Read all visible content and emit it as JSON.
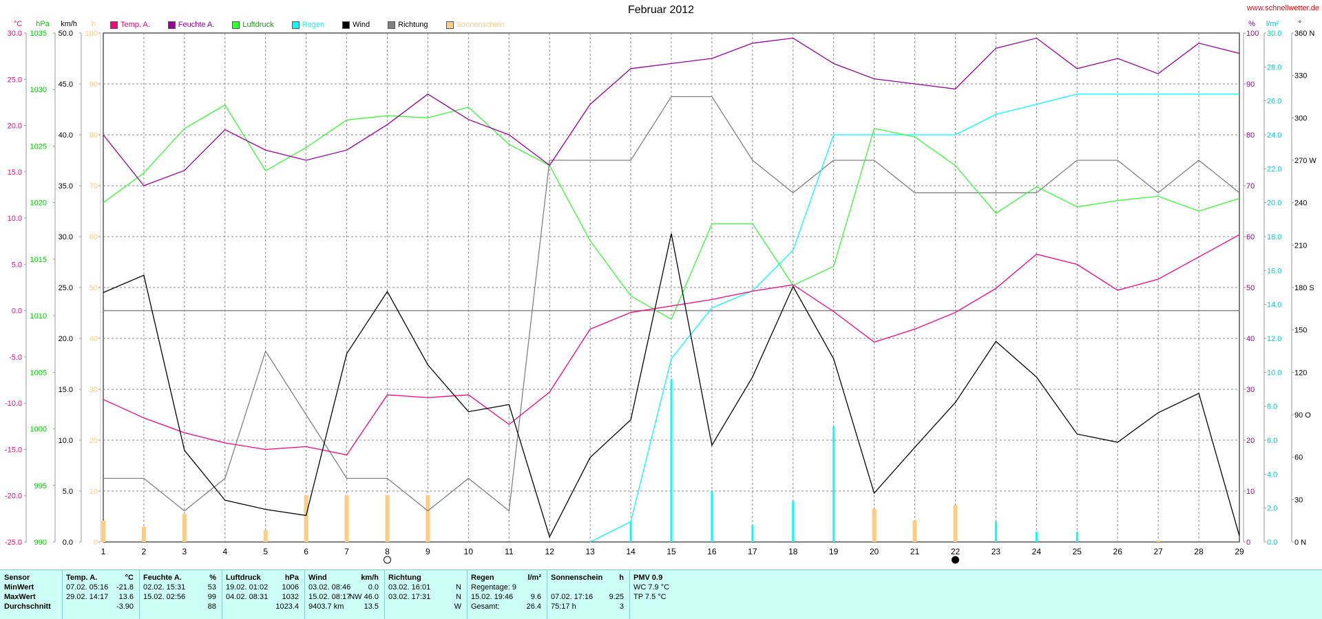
{
  "header": {
    "title": "Februar 2012",
    "brand": "www.schnellwetter.de"
  },
  "axes_units": {
    "temp": "°C",
    "pressure": "hPa",
    "wind": "km/h",
    "sun": "h",
    "humidity": "%",
    "rain": "l/m²",
    "direction": "°"
  },
  "legend": [
    {
      "label": "Temp. A.",
      "color": "#ff0080"
    },
    {
      "label": "Feuchte A.",
      "color": "#990099"
    },
    {
      "label": "Luftdruck",
      "color": "#33ff33"
    },
    {
      "label": "Regen",
      "color": "#00ffff"
    },
    {
      "label": "Wind",
      "color": "#000000"
    },
    {
      "label": "Richtung",
      "color": "#808080"
    },
    {
      "label": "Sonnenschein",
      "color": "#ffcc80"
    }
  ],
  "chart_data": {
    "type": "line",
    "title": "Februar 2012",
    "x": [
      1,
      2,
      3,
      4,
      5,
      6,
      7,
      8,
      9,
      10,
      11,
      12,
      13,
      14,
      15,
      16,
      17,
      18,
      19,
      20,
      21,
      22,
      23,
      24,
      25,
      26,
      27,
      28,
      29
    ],
    "x_ticks": [
      "1",
      "2",
      "3",
      "4",
      "5",
      "6",
      "7",
      "8",
      "9",
      "10",
      "11",
      "12",
      "13",
      "14",
      "15",
      "16",
      "17",
      "18",
      "19",
      "20",
      "21",
      "22",
      "23",
      "24",
      "25",
      "26",
      "27",
      "28",
      "29"
    ],
    "grid": true,
    "axes": {
      "temp": {
        "unit": "°C",
        "range": [
          -25,
          30
        ],
        "ticks": [
          "30.0",
          "25.0",
          "20.0",
          "15.0",
          "10.0",
          "5.0",
          "0.0",
          "-5.0",
          "-10.0",
          "-15.0",
          "-20.0",
          "-25.0"
        ],
        "color": "#ff0080"
      },
      "pressure": {
        "unit": "hPa",
        "range": [
          990,
          1038
        ],
        "ticks": [
          "1035",
          "1030",
          "1025",
          "1020",
          "1015",
          "1010",
          "1005",
          "1000",
          "995",
          "990"
        ],
        "color": "#00cc00"
      },
      "wind": {
        "unit": "km/h",
        "range": [
          0,
          50
        ],
        "ticks": [
          "50.0",
          "45.0",
          "40.0",
          "35.0",
          "30.0",
          "25.0",
          "20.0",
          "15.0",
          "10.0",
          "5.0",
          "0.0"
        ],
        "color": "#000000"
      },
      "sun": {
        "unit": "h",
        "range": [
          0,
          100
        ],
        "ticks": [
          "100",
          "90",
          "80",
          "70",
          "60",
          "50",
          "40",
          "30",
          "20",
          "10",
          "0"
        ],
        "color": "#ffcc80"
      },
      "humidity": {
        "unit": "%",
        "range": [
          0,
          100
        ],
        "ticks": [
          "100",
          "90",
          "80",
          "70",
          "60",
          "50",
          "40",
          "30",
          "20",
          "10",
          "0"
        ],
        "color": "#990099"
      },
      "rain": {
        "unit": "l/m²",
        "range": [
          0,
          30
        ],
        "ticks": [
          "30.0",
          "28.0",
          "26.0",
          "24.0",
          "22.0",
          "20.0",
          "18.0",
          "16.0",
          "14.0",
          "12.0",
          "10.0",
          "8.0",
          "6.0",
          "4.0",
          "2.0",
          "0.0"
        ],
        "color": "#00ffff"
      },
      "direction": {
        "unit": "°",
        "range": [
          0,
          360
        ],
        "ticks": [
          "360 N",
          "330",
          "300",
          "270 W",
          "240",
          "210",
          "180 S",
          "150",
          "120",
          "90 O",
          "60",
          "30",
          "0 N"
        ],
        "color": "#000000"
      }
    },
    "series": [
      {
        "name": "Temp. A.",
        "axis": "temp",
        "color": "#ff0080",
        "values": [
          -9.6,
          -11.6,
          -13.2,
          -14.3,
          -15.0,
          -14.7,
          -15.6,
          -9.1,
          -9.4,
          -9.1,
          -12.3,
          -8.8,
          -2.0,
          -0.2,
          0.5,
          1.2,
          2.1,
          2.8,
          -0.1,
          -3.4,
          -2.0,
          -0.2,
          2.4,
          6.1,
          5.0,
          2.2,
          3.4,
          5.8,
          8.2
        ]
      },
      {
        "name": "Feuchte A.",
        "axis": "humidity",
        "color": "#990099",
        "values": [
          80,
          70,
          73,
          81,
          77,
          75,
          77,
          82,
          88,
          83,
          80,
          74,
          86,
          93,
          94,
          95,
          98,
          99,
          94,
          91,
          90,
          89,
          97,
          99,
          93,
          95,
          92,
          98,
          96
        ]
      },
      {
        "name": "Luftdruck",
        "axis": "pressure",
        "color": "#33ff33",
        "values": [
          1022,
          1024.8,
          1029,
          1031.2,
          1025,
          1027.2,
          1029.8,
          1030.2,
          1030,
          1031,
          1027.5,
          1025.5,
          1018.4,
          1013.2,
          1011,
          1020,
          1020,
          1014.2,
          1016,
          1029,
          1028.2,
          1025.5,
          1021,
          1023.5,
          1021.6,
          1022.2,
          1022.6,
          1021.2,
          1022.4
        ]
      },
      {
        "name": "Regen",
        "axis": "rain",
        "color": "#00ffff",
        "values": [
          null,
          null,
          null,
          null,
          null,
          null,
          null,
          null,
          null,
          null,
          null,
          null,
          0,
          1.2,
          10.8,
          13.8,
          14.8,
          17.2,
          24,
          24,
          24,
          24,
          25.2,
          25.8,
          26.4,
          26.4,
          26.4,
          26.4,
          26.4
        ]
      },
      {
        "name": "Wind",
        "axis": "wind",
        "color": "#000000",
        "values": [
          24.5,
          26.2,
          9.0,
          4.1,
          3.2,
          2.6,
          18.5,
          24.6,
          17.4,
          12.8,
          13.5,
          0.5,
          8.3,
          12.0,
          30.3,
          9.5,
          16.2,
          25.1,
          18.0,
          4.8,
          9.3,
          13.7,
          19.7,
          16.2,
          10.6,
          9.8,
          12.7,
          14.6,
          0.6
        ]
      },
      {
        "name": "Richtung",
        "axis": "direction",
        "color": "#808080",
        "values": [
          45,
          45,
          22,
          45,
          135,
          90,
          45,
          45,
          22,
          45,
          22,
          270,
          270,
          270,
          315,
          315,
          270,
          247,
          270,
          270,
          247,
          247,
          247,
          247,
          270,
          270,
          247,
          270,
          247
        ]
      }
    ],
    "bars": [
      {
        "name": "Sonnenschein",
        "axis": "sun",
        "color": "#ffcc80",
        "values": [
          4.2,
          3.0,
          5.5,
          0,
          2.3,
          9.2,
          9.2,
          9.2,
          9.2,
          0,
          0,
          0,
          0,
          0,
          0,
          0,
          0,
          0,
          0,
          6.5,
          4.2,
          7.2,
          0,
          0,
          0,
          0,
          0.3,
          0,
          0
        ]
      },
      {
        "name": "Regen (Tag)",
        "axis": "rain",
        "color": "#00ffff",
        "values": [
          0,
          0,
          0,
          0,
          0,
          0,
          0,
          0,
          0,
          0,
          0,
          0,
          0,
          1.2,
          9.6,
          3.0,
          1.0,
          2.4,
          6.8,
          0,
          0,
          0,
          1.2,
          0.6,
          0.6,
          0,
          0,
          0,
          0
        ]
      }
    ],
    "sun_bar_colors_green_days": [
      19,
      25
    ],
    "moon": [
      {
        "day": 8,
        "phase": "full"
      },
      {
        "day": 22,
        "phase": "new"
      }
    ]
  },
  "table": {
    "sensor": {
      "header": "Sensor",
      "rows": [
        "MinWert",
        "MaxWert",
        "Durchschnitt"
      ]
    },
    "temp": {
      "header": "Temp. A.",
      "unit": "°C",
      "rows": [
        {
          "date": "07.02.",
          "time": "05:16",
          "value": "-21.8"
        },
        {
          "date": "29.02.",
          "time": "14:17",
          "value": "13.6"
        },
        {
          "date": "",
          "time": "",
          "value": "-3.90"
        }
      ]
    },
    "hum": {
      "header": "Feuchte A.",
      "unit": "%",
      "rows": [
        {
          "date": "02.02.",
          "time": "15:31",
          "value": "53"
        },
        {
          "date": "15.02.",
          "time": "02:56",
          "value": "99"
        },
        {
          "date": "",
          "time": "",
          "value": "88"
        }
      ]
    },
    "press": {
      "header": "Luftdruck",
      "unit": "hPa",
      "rows": [
        {
          "date": "19.02.",
          "time": "01:02",
          "value": "1006"
        },
        {
          "date": "04.02.",
          "time": "08:31",
          "value": "1032"
        },
        {
          "date": "",
          "time": "",
          "value": "1023.4"
        }
      ]
    },
    "wind": {
      "header": "Wind",
      "unit": "km/h",
      "rows": [
        {
          "date": "03.02.",
          "time": "08:46",
          "value": "0.0"
        },
        {
          "date": "15.02.",
          "time": "08:17",
          "value": "NW 46.0"
        },
        {
          "date": "9403.7 km",
          "time": "",
          "value": "13.5"
        }
      ]
    },
    "dir": {
      "header": "Richtung",
      "rows": [
        {
          "date": "03.02.",
          "time": "16:01",
          "value": "N"
        },
        {
          "date": "03.02.",
          "time": "17:31",
          "value": "N"
        },
        {
          "date": "",
          "time": "",
          "value": "W"
        }
      ]
    },
    "rain": {
      "header": "Regen",
      "unit": "l/m²",
      "rows": [
        {
          "text": "Regentage: 9",
          "value": ""
        },
        {
          "text": "15.02.  19:46",
          "value": "9.6"
        },
        {
          "text": "Gesamt:",
          "value": "26.4"
        }
      ]
    },
    "sun": {
      "header": "Sonnenschein",
      "unit": "h",
      "rows": [
        {
          "text": "",
          "value": ""
        },
        {
          "text": "07.02.  17:16",
          "value": "9.25"
        },
        {
          "text": "75:17 h",
          "value": "3"
        }
      ]
    },
    "pmv": {
      "header": "PMV 0.9",
      "rows": [
        "WC 7.9 °C",
        "TP 7.5 °C"
      ]
    }
  }
}
